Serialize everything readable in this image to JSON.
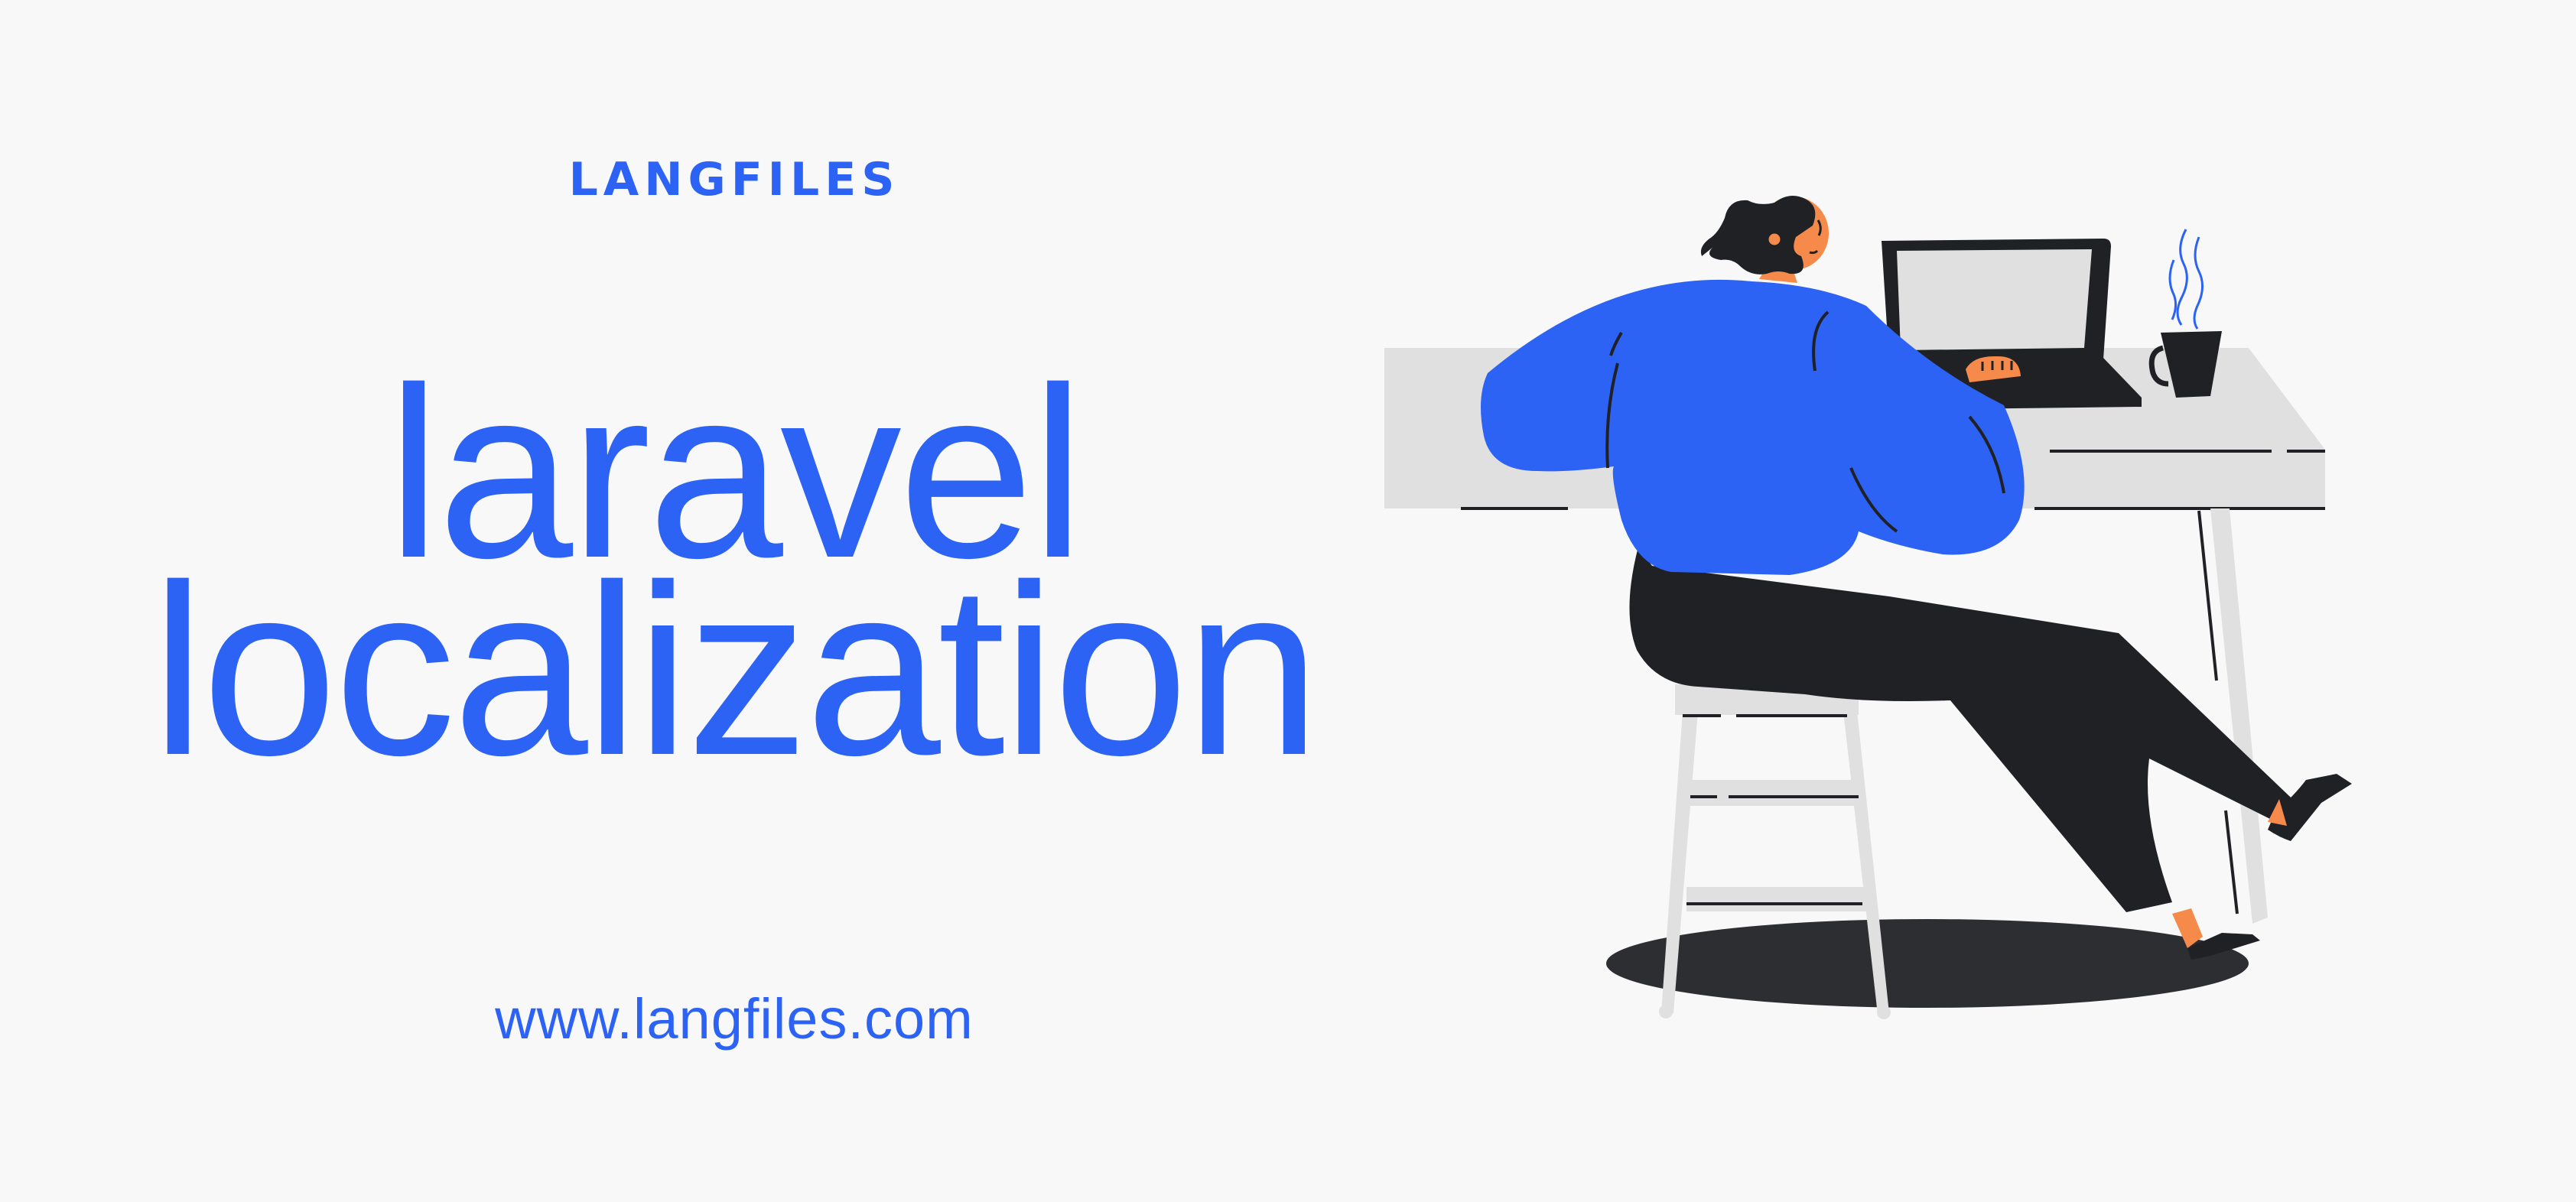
{
  "brand": {
    "logo_text": "LANGFILES"
  },
  "headline": {
    "line1": "laravel",
    "line2": "localization"
  },
  "footer": {
    "url": "www.langfiles.com"
  },
  "illustration": {
    "subject": "person-working-at-laptop-illustration"
  },
  "colors": {
    "accent": "#2c63f5",
    "background": "#f8f8f8",
    "dark": "#202124",
    "skin": "#f58a4b",
    "desk": "#e0e0e0"
  }
}
